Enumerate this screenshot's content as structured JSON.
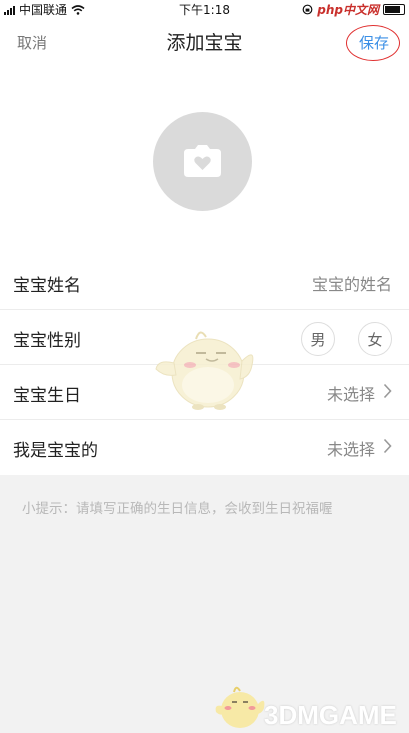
{
  "status_bar": {
    "carrier": "中国联通",
    "time": "下午1:18",
    "right_text": "php中文网"
  },
  "nav": {
    "cancel_label": "取消",
    "title": "添加宝宝",
    "save_label": "保存"
  },
  "avatar": {
    "icon": "camera-heart-icon"
  },
  "form": {
    "name_label": "宝宝姓名",
    "name_placeholder": "宝宝的姓名",
    "gender_label": "宝宝性别",
    "gender_male": "男",
    "gender_female": "女",
    "birthday_label": "宝宝生日",
    "birthday_value": "未选择",
    "relation_label": "我是宝宝的",
    "relation_value": "未选择"
  },
  "hint": "小提示：请填写正确的生日信息，会收到生日祝福喔",
  "watermark": "3DMGAME",
  "colors": {
    "accent": "#3b8fe6",
    "highlight_ring": "#e03030",
    "background": "#f2f2f2",
    "avatar_bg": "#dadada"
  }
}
